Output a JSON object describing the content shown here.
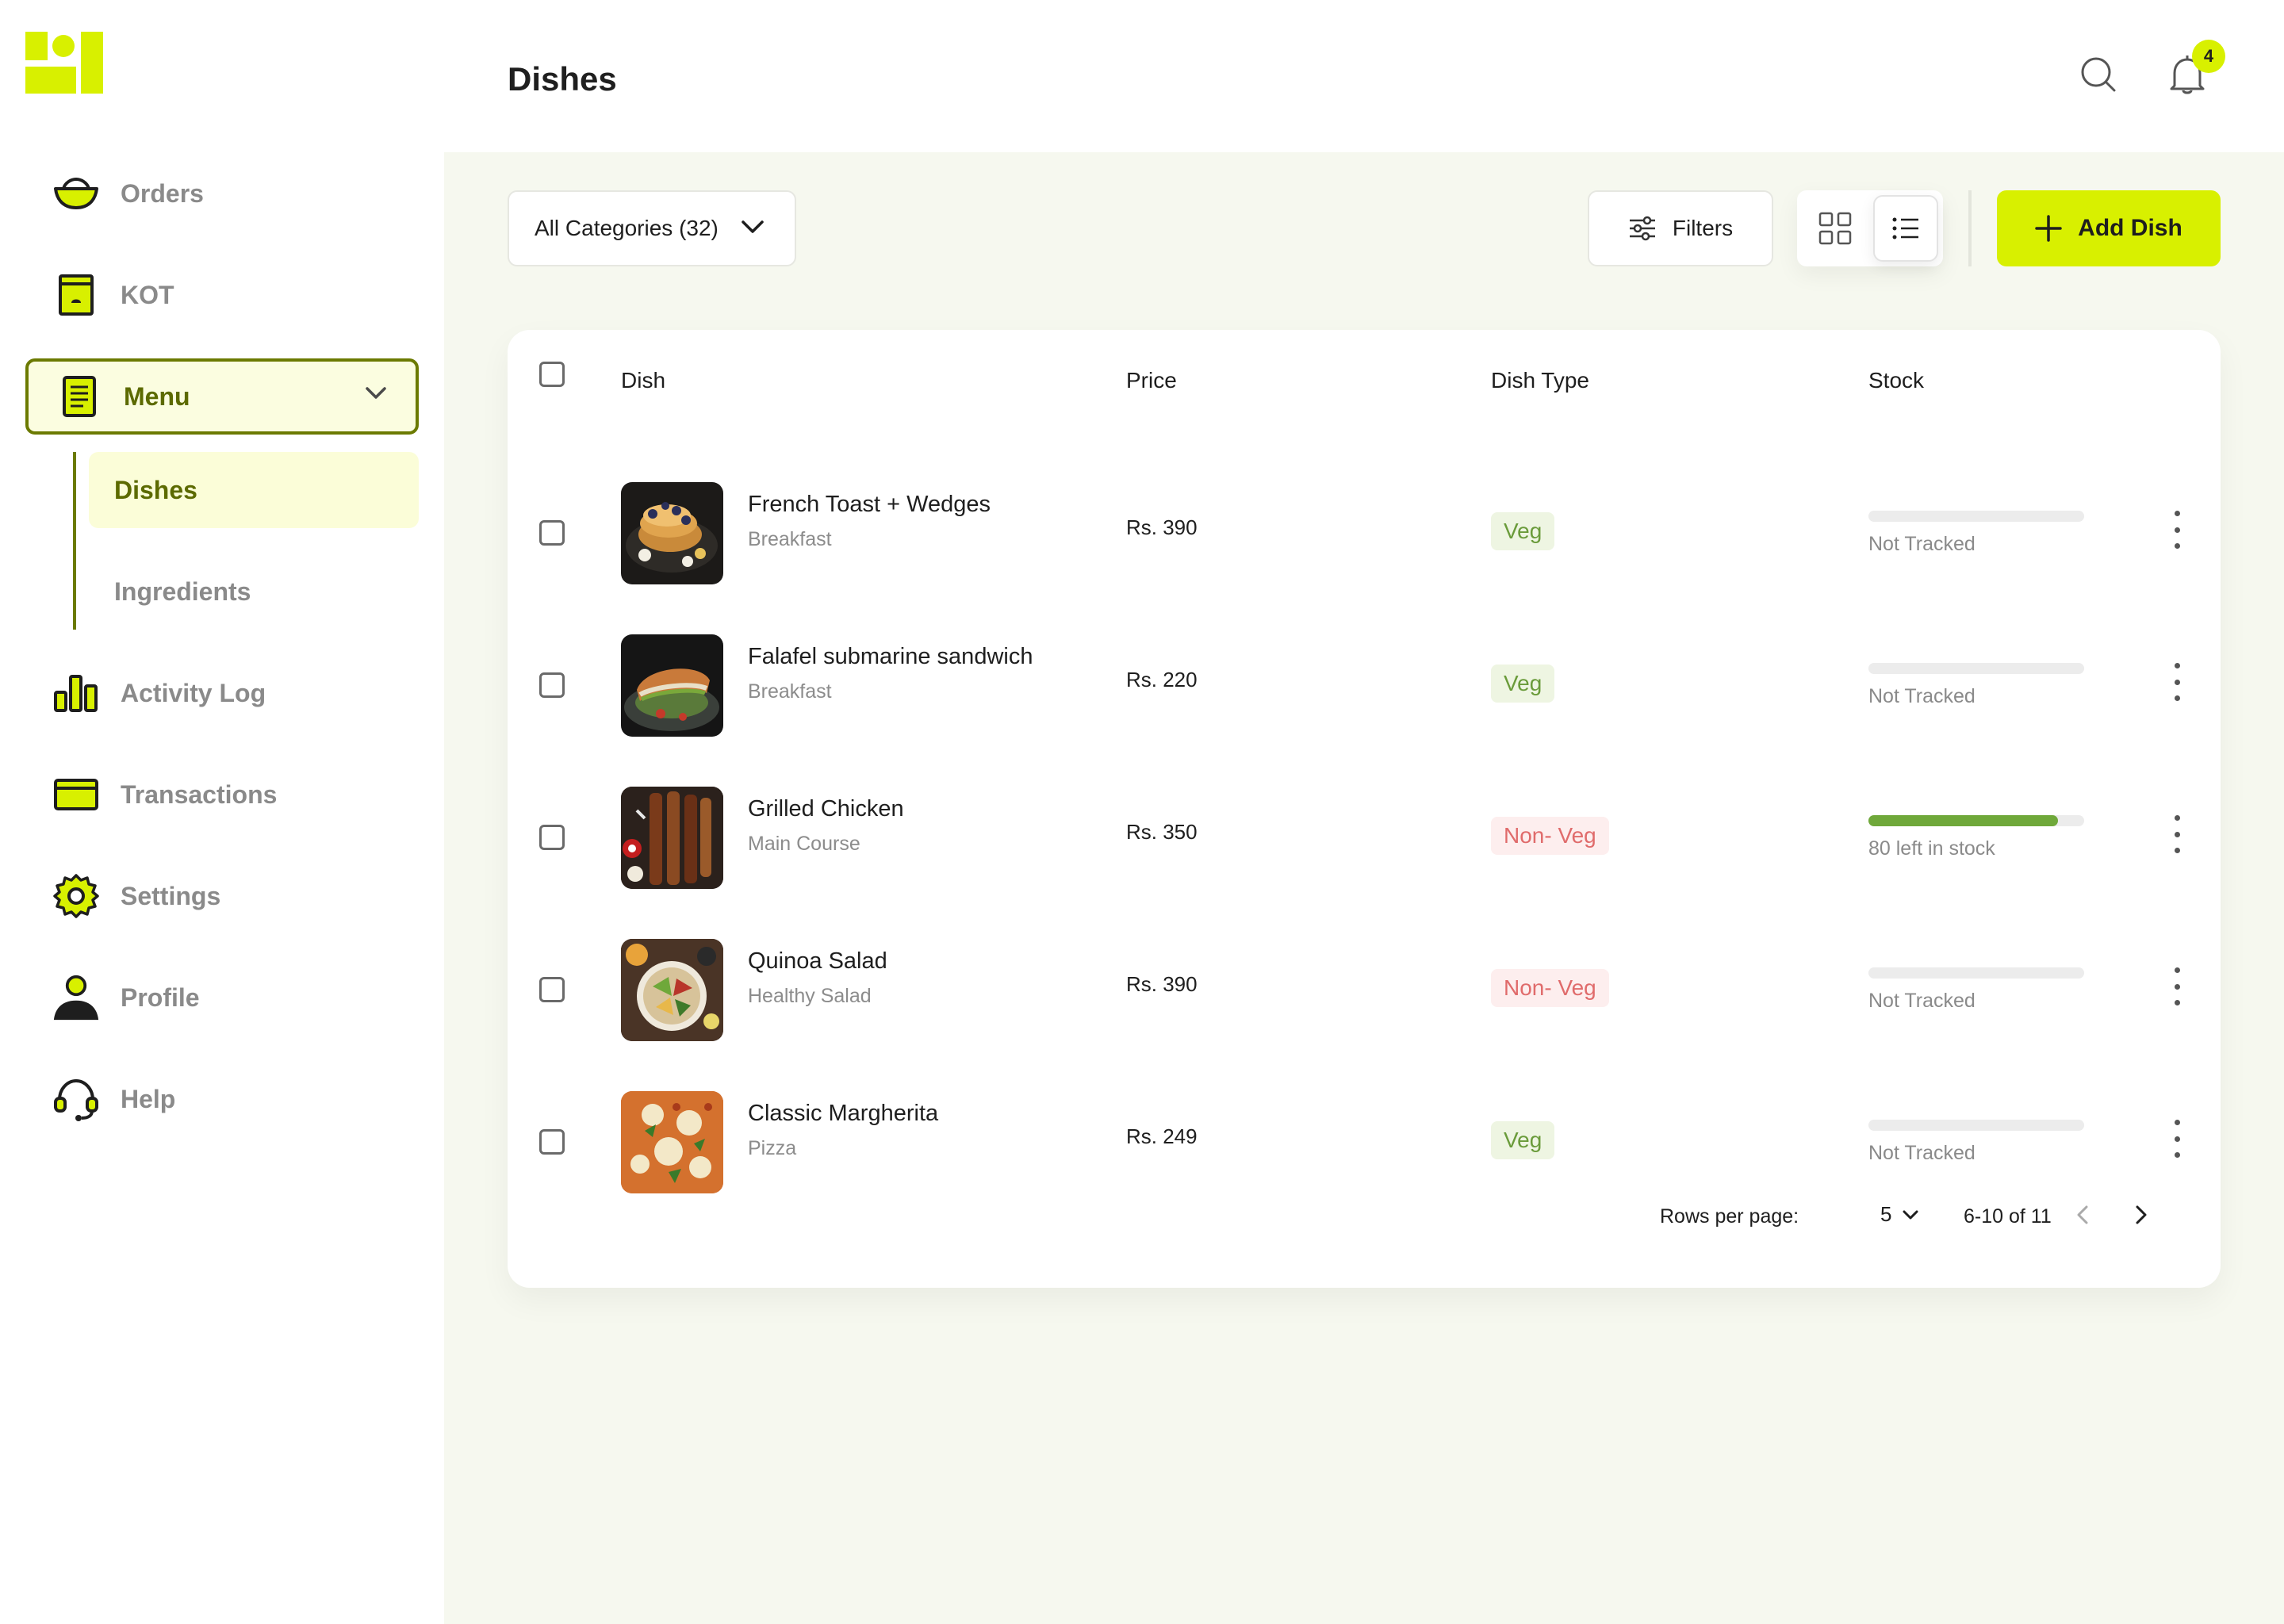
{
  "sidebar": {
    "items": [
      {
        "label": "Orders",
        "icon": "bowl-icon"
      },
      {
        "label": "KOT",
        "icon": "receipt-jar-icon"
      },
      {
        "label": "Menu",
        "icon": "menu-document-icon"
      },
      {
        "label": "Activity Log",
        "icon": "bar-chart-icon"
      },
      {
        "label": "Transactions",
        "icon": "card-icon"
      },
      {
        "label": "Settings",
        "icon": "gear-icon"
      },
      {
        "label": "Profile",
        "icon": "user-icon"
      },
      {
        "label": "Help",
        "icon": "headset-icon"
      }
    ],
    "submenu": [
      {
        "label": "Dishes",
        "active": true
      },
      {
        "label": "Ingredients",
        "active": false
      }
    ]
  },
  "header": {
    "title": "Dishes",
    "notification_count": "4"
  },
  "toolbar": {
    "category_select": "All Categories (32)",
    "filters_label": "Filters",
    "add_label": "Add Dish"
  },
  "table": {
    "columns": [
      "Dish",
      "Price",
      "Dish Type",
      "Stock"
    ],
    "rows": [
      {
        "name": "French Toast + Wedges",
        "category": "Breakfast",
        "price": "Rs. 390",
        "type": "Veg",
        "stock_text": "Not Tracked",
        "stock_fraction": 0
      },
      {
        "name": "Falafel submarine sandwich",
        "category": "Breakfast",
        "price": "Rs. 220",
        "type": "Veg",
        "stock_text": "Not Tracked",
        "stock_fraction": 0
      },
      {
        "name": "Grilled Chicken",
        "category": "Main Course",
        "price": "Rs. 350",
        "type": "Non- Veg",
        "stock_text": "80 left in stock",
        "stock_fraction": 0.88
      },
      {
        "name": "Quinoa Salad",
        "category": "Healthy Salad",
        "price": "Rs. 390",
        "type": "Non- Veg",
        "stock_text": "Not Tracked",
        "stock_fraction": 0
      },
      {
        "name": "Classic Margherita",
        "category": "Pizza",
        "price": "Rs. 249",
        "type": "Veg",
        "stock_text": "Not Tracked",
        "stock_fraction": 0
      }
    ]
  },
  "pagination": {
    "rows_per_page_label": "Rows per page:",
    "rows_per_page_value": "5",
    "range": "6-10 of 11"
  },
  "colors": {
    "accent": "#d8f000",
    "accent_dark": "#6b7a00",
    "veg": "#6a9b3a",
    "non_veg": "#e06b6b",
    "stock_bar": "#6fa83a"
  }
}
